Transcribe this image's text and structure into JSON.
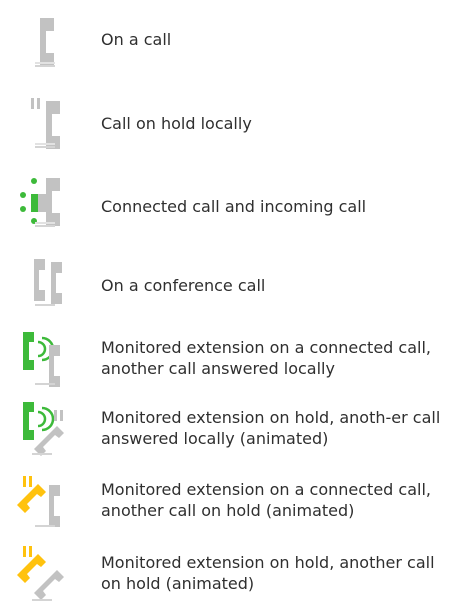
{
  "legend": {
    "items": [
      {
        "icon": "on-a-call-icon",
        "text": "On a call"
      },
      {
        "icon": "call-on-hold-icon",
        "text": "Call on hold locally"
      },
      {
        "icon": "connected-and-incoming-call-icon",
        "text": "Connected call and incoming call"
      },
      {
        "icon": "conference-call-icon",
        "text": "On a conference call"
      },
      {
        "icon": "monitored-connected-answered-icon",
        "text": "Monitored extension on a connected call, another call answered locally"
      },
      {
        "icon": "monitored-hold-answered-icon",
        "text": "Monitored extension on hold, anoth-er call answered locally (animated)"
      },
      {
        "icon": "monitored-connected-hold-icon",
        "text": "Monitored extension on a connected call, another call on hold (animated)"
      },
      {
        "icon": "monitored-hold-hold-icon",
        "text": "Monitored extension on hold, another call on hold (animated)"
      }
    ]
  },
  "colors": {
    "handset_gray": "#c2c2c2",
    "green": "#3dba3a",
    "yellow": "#ffc20e",
    "text": "#2f2f2f"
  }
}
